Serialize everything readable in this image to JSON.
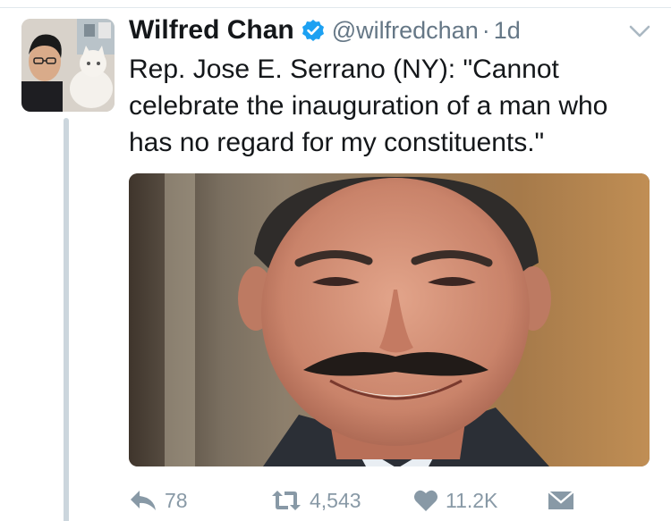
{
  "tweet": {
    "author": {
      "display_name": "Wilfred Chan",
      "handle": "@wilfredchan",
      "verified": true
    },
    "separator": "·",
    "timestamp": "1d",
    "text": "Rep. Jose E. Serrano (NY): \"Cannot celebrate the inauguration of a man who has no regard for my constituents.\"",
    "actions": {
      "reply_count": "78",
      "retweet_count": "4,543",
      "like_count": "11.2K"
    }
  },
  "colors": {
    "text": "#14171a",
    "secondary_text": "#657786",
    "action_gray": "#8899a6",
    "verified_blue": "#1da1f2",
    "divider": "#e1e8ed"
  },
  "icons": {
    "verified": "verified-badge-icon",
    "caret": "chevron-down-icon",
    "reply": "reply-icon",
    "retweet": "retweet-icon",
    "like": "heart-icon",
    "dm": "envelope-icon"
  }
}
